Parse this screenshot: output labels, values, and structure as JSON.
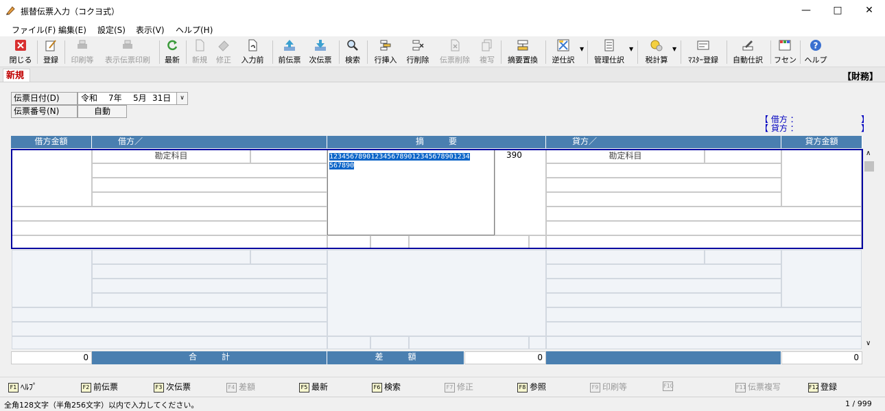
{
  "window": {
    "title": "振替伝票入力（コクヨ式）"
  },
  "menu": [
    "ファイル(F)",
    "編集(E)",
    "設定(S)",
    "表示(V)",
    "ヘルプ(H)"
  ],
  "toolbar": {
    "close": "閉じる",
    "register": "登録",
    "print": "印刷等",
    "print_display": "表示伝票印刷",
    "refresh": "最新",
    "new": "新規",
    "modify": "修正",
    "prev_input": "入力前",
    "prev_slip": "前伝票",
    "next_slip": "次伝票",
    "search": "検索",
    "insert_row": "行挿入",
    "delete_row": "行削除",
    "delete_slip": "伝票削除",
    "copy": "複写",
    "replace_summary": "摘要置換",
    "reverse_entry": "逆仕訳",
    "mgmt_entry": "管理仕訳",
    "tax_calc": "税計算",
    "master_register": "ﾏｽﾀｰ登録",
    "auto_entry": "自動仕訳",
    "sticky": "フセン",
    "help": "ヘルプ"
  },
  "mode": {
    "label": "新規",
    "department": "【財務】"
  },
  "form": {
    "date_label": "伝票日付(D)",
    "date_era": "令和",
    "date_year": "7年",
    "date_month": "5月",
    "date_day": "31日",
    "number_label": "伝票番号(N)",
    "number_value": "自動"
  },
  "balance": {
    "debit_label": "【 借方 ：",
    "credit_label": "【 貸方 ：",
    "close_bracket": "】"
  },
  "grid": {
    "headers": {
      "debit_amount": "借方金額",
      "debit_account": "借方／",
      "summary": "摘　　　要",
      "credit_account": "貸方／",
      "credit_amount": "貸方金額"
    },
    "account_title": "勘定科目",
    "summary_text_line1": "1234567890123456789012345678901234",
    "summary_text_line2": "567890",
    "summary_suffix": "390"
  },
  "totals": {
    "debit_total": "0",
    "total_label": "合　　　計",
    "diff_label": "差　　　額",
    "diff_value": "0",
    "credit_total": "0"
  },
  "fkeys": [
    {
      "key": "F1",
      "label": "ﾍﾙﾌﾟ"
    },
    {
      "key": "F2",
      "label": "前伝票"
    },
    {
      "key": "F3",
      "label": "次伝票"
    },
    {
      "key": "F4",
      "label": "差額"
    },
    {
      "key": "F5",
      "label": "最新"
    },
    {
      "key": "F6",
      "label": "検索"
    },
    {
      "key": "F7",
      "label": "修正"
    },
    {
      "key": "F8",
      "label": "参照"
    },
    {
      "key": "F9",
      "label": "印刷等"
    },
    {
      "key": "F10",
      "label": ""
    },
    {
      "key": "F11",
      "label": "伝票複写"
    },
    {
      "key": "F12",
      "label": "登録"
    }
  ],
  "status": {
    "message": "全角128文字（半角256文字）以内で入力してください。",
    "counter": "1 / 999"
  },
  "colors": {
    "header_blue": "#4a7fb0",
    "selection_border": "#0000a0",
    "mode_red": "#c00000"
  }
}
